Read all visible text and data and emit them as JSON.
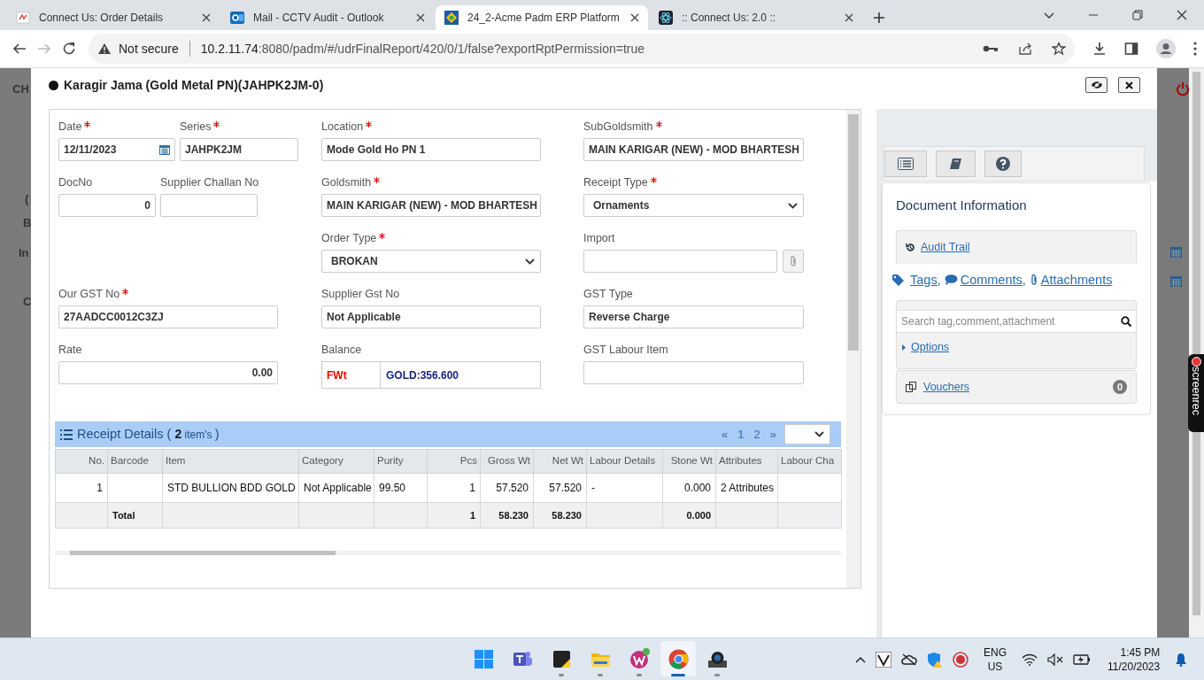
{
  "browser": {
    "tabs": [
      {
        "kind": "connect",
        "title": "Connect Us: Order Details",
        "selected": false
      },
      {
        "kind": "outlook",
        "title": "Mail - CCTV Audit - Outlook",
        "selected": false
      },
      {
        "kind": "erp",
        "title": "24_2-Acme Padm ERP Platform",
        "selected": true
      },
      {
        "kind": "react",
        "title": ":: Connect Us: 2.0 ::",
        "selected": false
      }
    ],
    "forward_disabled": true,
    "security": "Not secure",
    "url_host": "10.2.11.74",
    "url_rest": ":8080/padm/#/udrFinalReport/420/0/1/false?exportRptPermission=true"
  },
  "background_fragments": [
    "CH",
    "(",
    "B",
    "In",
    "C"
  ],
  "modal": {
    "title": "Karagir Jama (Gold Metal PN)(JAHPK2JM-0)"
  },
  "form": {
    "rows": [
      {
        "left": [
          {
            "kind": "date",
            "label": "Date",
            "required": true,
            "value": "12/11/2023"
          },
          {
            "kind": "text",
            "label": "Series",
            "required": true,
            "value": "JAHPK2JM"
          }
        ],
        "middle": {
          "kind": "text",
          "label": "Location",
          "required": true,
          "value": "Mode Gold Ho PN 1"
        },
        "right": {
          "kind": "text",
          "label": "SubGoldsmith",
          "required": true,
          "value": "MAIN KARIGAR (NEW) - MOD BHARTESH"
        }
      },
      {
        "left": [
          {
            "kind": "number",
            "label": "DocNo",
            "required": false,
            "value": "0"
          },
          {
            "kind": "text",
            "label": "Supplier Challan No",
            "required": false
          }
        ],
        "middle": {
          "kind": "text",
          "label": "Goldsmith",
          "required": true,
          "value": "MAIN KARIGAR (NEW) - MOD BHARTESH"
        },
        "right": {
          "kind": "select",
          "label": "Receipt Type",
          "required": true,
          "value": "Ornaments"
        }
      },
      {
        "middle": {
          "kind": "select",
          "label": "Order Type",
          "required": true,
          "value": "BROKAN"
        },
        "right": {
          "kind": "file",
          "label": "Import",
          "required": false
        }
      },
      {
        "left": [
          {
            "kind": "text",
            "label": "Our GST No",
            "required": true,
            "value": "27AADCC0012C3ZJ"
          }
        ],
        "middle": {
          "kind": "text",
          "label": "Supplier Gst No",
          "required": false,
          "value": "Not Applicable"
        },
        "right": {
          "kind": "text",
          "label": "GST Type",
          "required": false,
          "value": "Reverse Charge"
        }
      },
      {
        "left": [
          {
            "kind": "number",
            "label": "Rate",
            "required": false,
            "value": "0.00"
          }
        ],
        "middle": {
          "kind": "balance",
          "label": "Balance",
          "required": false,
          "tag": "FWt",
          "value": "GOLD:356.600"
        },
        "right": {
          "kind": "text",
          "label": "GST Labour Item",
          "required": false
        }
      }
    ]
  },
  "receipt_details": {
    "title": "Receipt Details (",
    "count": "2",
    "count_suffix": "item's",
    "close": ")",
    "pagination": [
      {
        "label": "«",
        "selected": false
      },
      {
        "label": "1",
        "selected": true
      },
      {
        "label": "2",
        "selected": false
      },
      {
        "label": "»",
        "selected": false
      }
    ],
    "columns": [
      {
        "label": "No.",
        "numeric": true,
        "value": "1"
      },
      {
        "label": "Barcode",
        "numeric": false,
        "total": "Total"
      },
      {
        "label": "Item",
        "numeric": false,
        "value": "STD BULLION BDD GOLD"
      },
      {
        "label": "Category",
        "numeric": false,
        "value": "Not Applicable"
      },
      {
        "label": "Purity",
        "numeric": false,
        "value": "99.50"
      },
      {
        "label": "Pcs",
        "numeric": true,
        "value": "1",
        "total": "1"
      },
      {
        "label": "Gross Wt",
        "numeric": true,
        "value": "57.520",
        "total": "58.230"
      },
      {
        "label": "Net Wt",
        "numeric": true,
        "value": "57.520",
        "total": "58.230"
      },
      {
        "label": "Labour Details",
        "numeric": false,
        "value": "-"
      },
      {
        "label": "Stone Wt",
        "numeric": true,
        "value": "0.000",
        "total": "0.000"
      },
      {
        "label": "Attributes",
        "numeric": false,
        "value": "2 Attributes"
      },
      {
        "label": "Labour Cha",
        "numeric": false
      }
    ]
  },
  "side_panel": {
    "title": "Document Information",
    "audit_trail": "Audit Trail",
    "links": [
      "Tags,",
      "Comments,",
      "Attachments"
    ],
    "search_placeholder": "Search tag,comment,attachment",
    "options": "Options",
    "vouchers": "Vouchers",
    "vouchers_count": "0"
  },
  "screenrec": "screenrec",
  "taskbar": {
    "apps": [
      {
        "kind": "start",
        "running": false,
        "selected": false
      },
      {
        "kind": "teams",
        "running": false,
        "selected": false
      },
      {
        "kind": "notes",
        "running": true,
        "selected": false
      },
      {
        "kind": "files",
        "running": true,
        "selected": false
      },
      {
        "kind": "wps",
        "running": true,
        "selected": false
      },
      {
        "kind": "chrome",
        "running": true,
        "selected": true
      },
      {
        "kind": "camera",
        "running": true,
        "selected": false
      }
    ],
    "language": "ENG",
    "region": "US",
    "volume_muted": true,
    "time": "1:45 PM",
    "date": "11/20/2023"
  }
}
